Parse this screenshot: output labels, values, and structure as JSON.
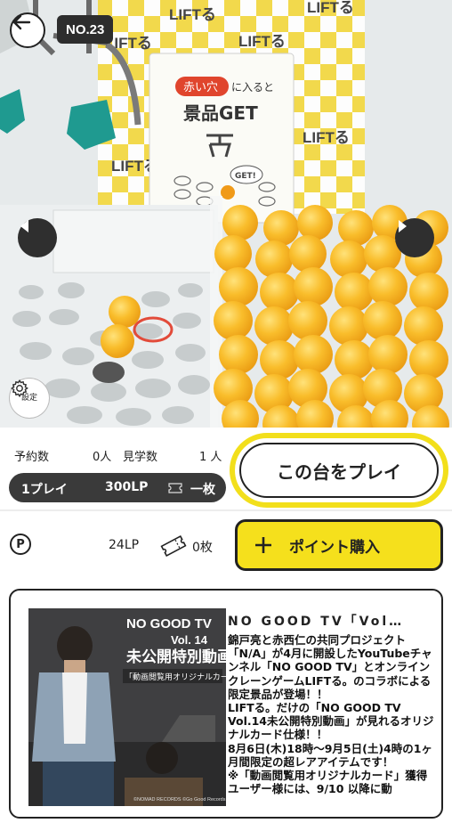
{
  "machine": {
    "number": "NO.23"
  },
  "camera": {
    "brand_signs": [
      "LIFTる",
      "LIFTる",
      "LIFTる",
      "LIFTる",
      "LIFTる",
      "LIFTる"
    ],
    "panel_tag": "赤い穴",
    "panel_tag_suffix": "に入ると",
    "panel_heading": "景品GET",
    "panel_bubble": "GET!",
    "settings_label": "設定"
  },
  "status": {
    "reserve_label": "予約数",
    "reserve_value": "0人",
    "watch_label": "見学数",
    "watch_value": "1 人"
  },
  "price": {
    "plays": "1プレイ",
    "cost": "300LP",
    "ticket": "一枚"
  },
  "play_button": "この台をプレイ",
  "wallet": {
    "points": "24LP",
    "tickets": "0枚"
  },
  "buy_button": "ポイント購入",
  "prize": {
    "title": "NO GOOD TV「Vol…",
    "description": "錦戸亮と赤西仁の共同プロジェクト「N/A」が4月に開設したYouTubeチャンネル「NO GOOD TV」とオンラインクレーンゲームLIFTる。のコラボによる限定景品が登場！！\nLIFTる。だけの「NO GOOD TV Vol.14未公開特別動画」が見れるオリジナルカード仕様！！\n8月6日(木)18時〜9月5日(土)4時の1ヶ月間限定の超レアアイテムです！\n※「動画閲覧用オリジナルカード」獲得ユーザー様には、9/10 以降に動",
    "image": {
      "title": "NO GOOD TV",
      "vol": "Vol. 14",
      "subtitle": "未公開特別動画",
      "caption": "「動画閲覧用オリジナルカード」",
      "copyright": "©NOMAD RECORDS ©Go Good Records"
    }
  },
  "colors": {
    "accent_yellow": "#f5e01c",
    "dark": "#2f2f2f",
    "ball_orange": "#f7b21d"
  }
}
